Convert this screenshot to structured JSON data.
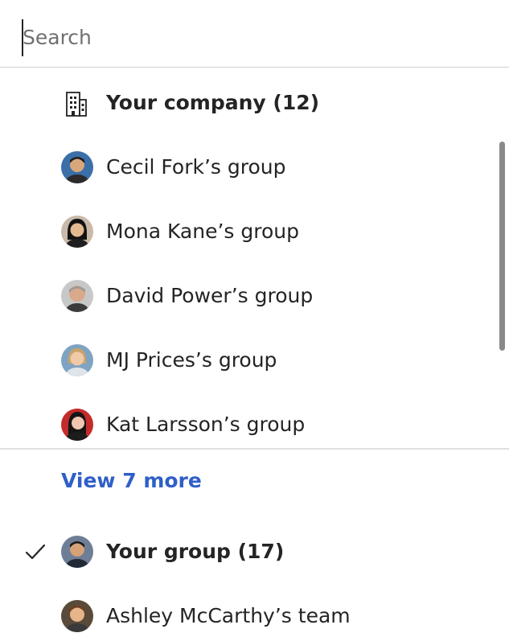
{
  "search": {
    "placeholder": "Search",
    "value": ""
  },
  "company": {
    "label": "Your company (12)",
    "icon": "building-icon"
  },
  "groups": [
    {
      "label": "Cecil Fork’s group",
      "avatar_bg": "#3a6fa8",
      "skin": "#d9a77c",
      "hair": "#1d1d1d"
    },
    {
      "label": "Mona Kane’s group",
      "avatar_bg": "#c9b9a8",
      "skin": "#e3b98f",
      "hair": "#111111"
    },
    {
      "label": "David Power’s group",
      "avatar_bg": "#c8c8c8",
      "skin": "#d8a98a",
      "hair": "#9a9a9a"
    },
    {
      "label": "MJ Prices’s group",
      "avatar_bg": "#7fa3c2",
      "skin": "#efc9a8",
      "hair": "#c9a46a"
    },
    {
      "label": "Kat Larsson’s group",
      "avatar_bg": "#c42b2b",
      "skin": "#f0c6b0",
      "hair": "#151515"
    }
  ],
  "view_more": {
    "label": "View 7 more",
    "color": "#2f5fc8"
  },
  "your_group": {
    "label": "Your group (17)",
    "selected": true,
    "icon": "checkmark-icon",
    "avatar_bg": "#6e7e96",
    "skin": "#d5a27a",
    "hair": "#1a1a1a"
  },
  "teams": [
    {
      "label": "Ashley McCarthy’s team",
      "avatar_bg": "#5a4a3a",
      "skin": "#e8b48a",
      "hair": "#6b4226"
    }
  ]
}
